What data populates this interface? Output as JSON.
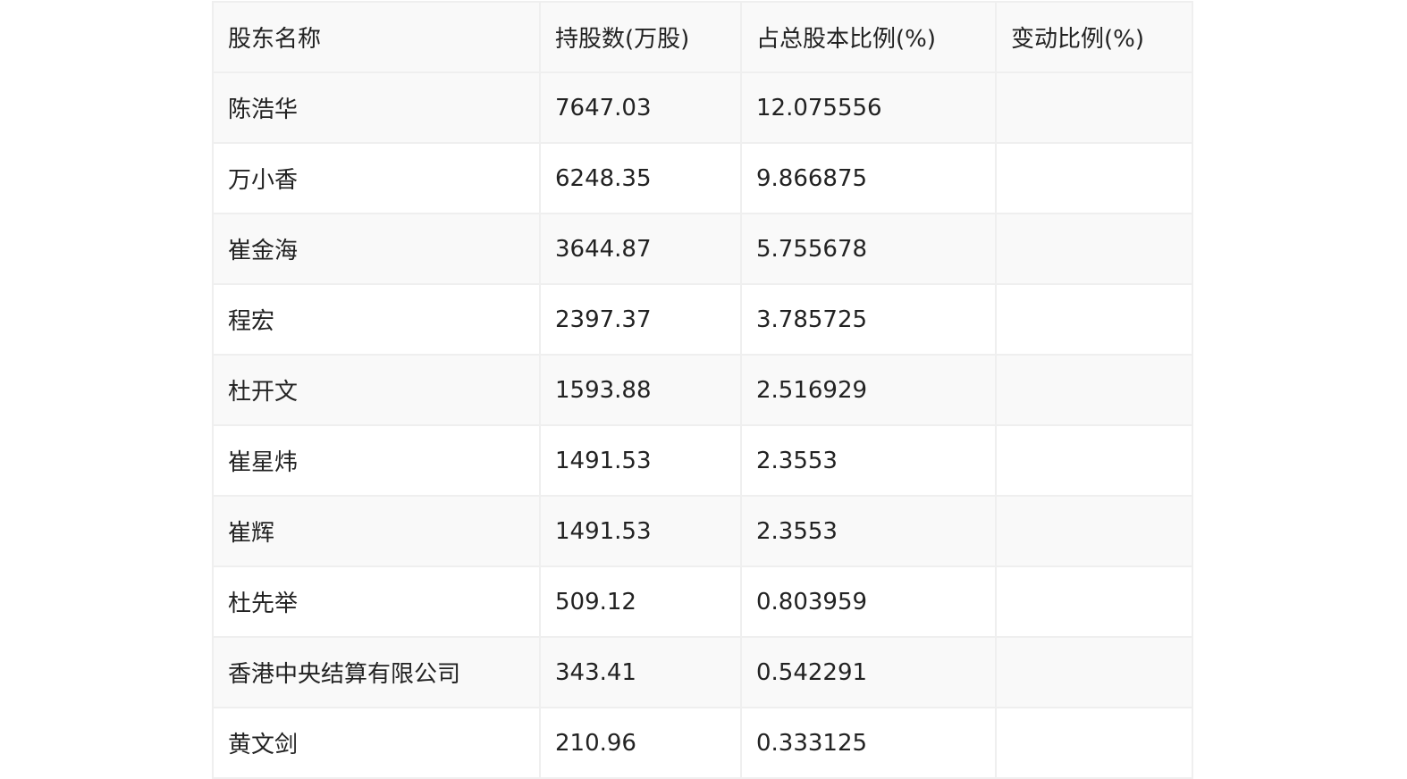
{
  "table": {
    "headers": [
      "股东名称",
      "持股数(万股)",
      "占总股本比例(%)",
      "变动比例(%)"
    ],
    "rows": [
      [
        "陈浩华",
        "7647.03",
        "12.075556",
        ""
      ],
      [
        "万小香",
        "6248.35",
        "9.866875",
        ""
      ],
      [
        "崔金海",
        "3644.87",
        "5.755678",
        ""
      ],
      [
        "程宏",
        "2397.37",
        "3.785725",
        ""
      ],
      [
        "杜开文",
        "1593.88",
        "2.516929",
        ""
      ],
      [
        "崔星炜",
        "1491.53",
        "2.3553",
        ""
      ],
      [
        "崔辉",
        "1491.53",
        "2.3553",
        ""
      ],
      [
        "杜先举",
        "509.12",
        "0.803959",
        ""
      ],
      [
        "香港中央结算有限公司",
        "343.41",
        "0.542291",
        ""
      ],
      [
        "黄文剑",
        "210.96",
        "0.333125",
        ""
      ]
    ]
  },
  "colors": {
    "border": "#efefef",
    "stripe": "#f9f9f9",
    "text": "#222222"
  }
}
